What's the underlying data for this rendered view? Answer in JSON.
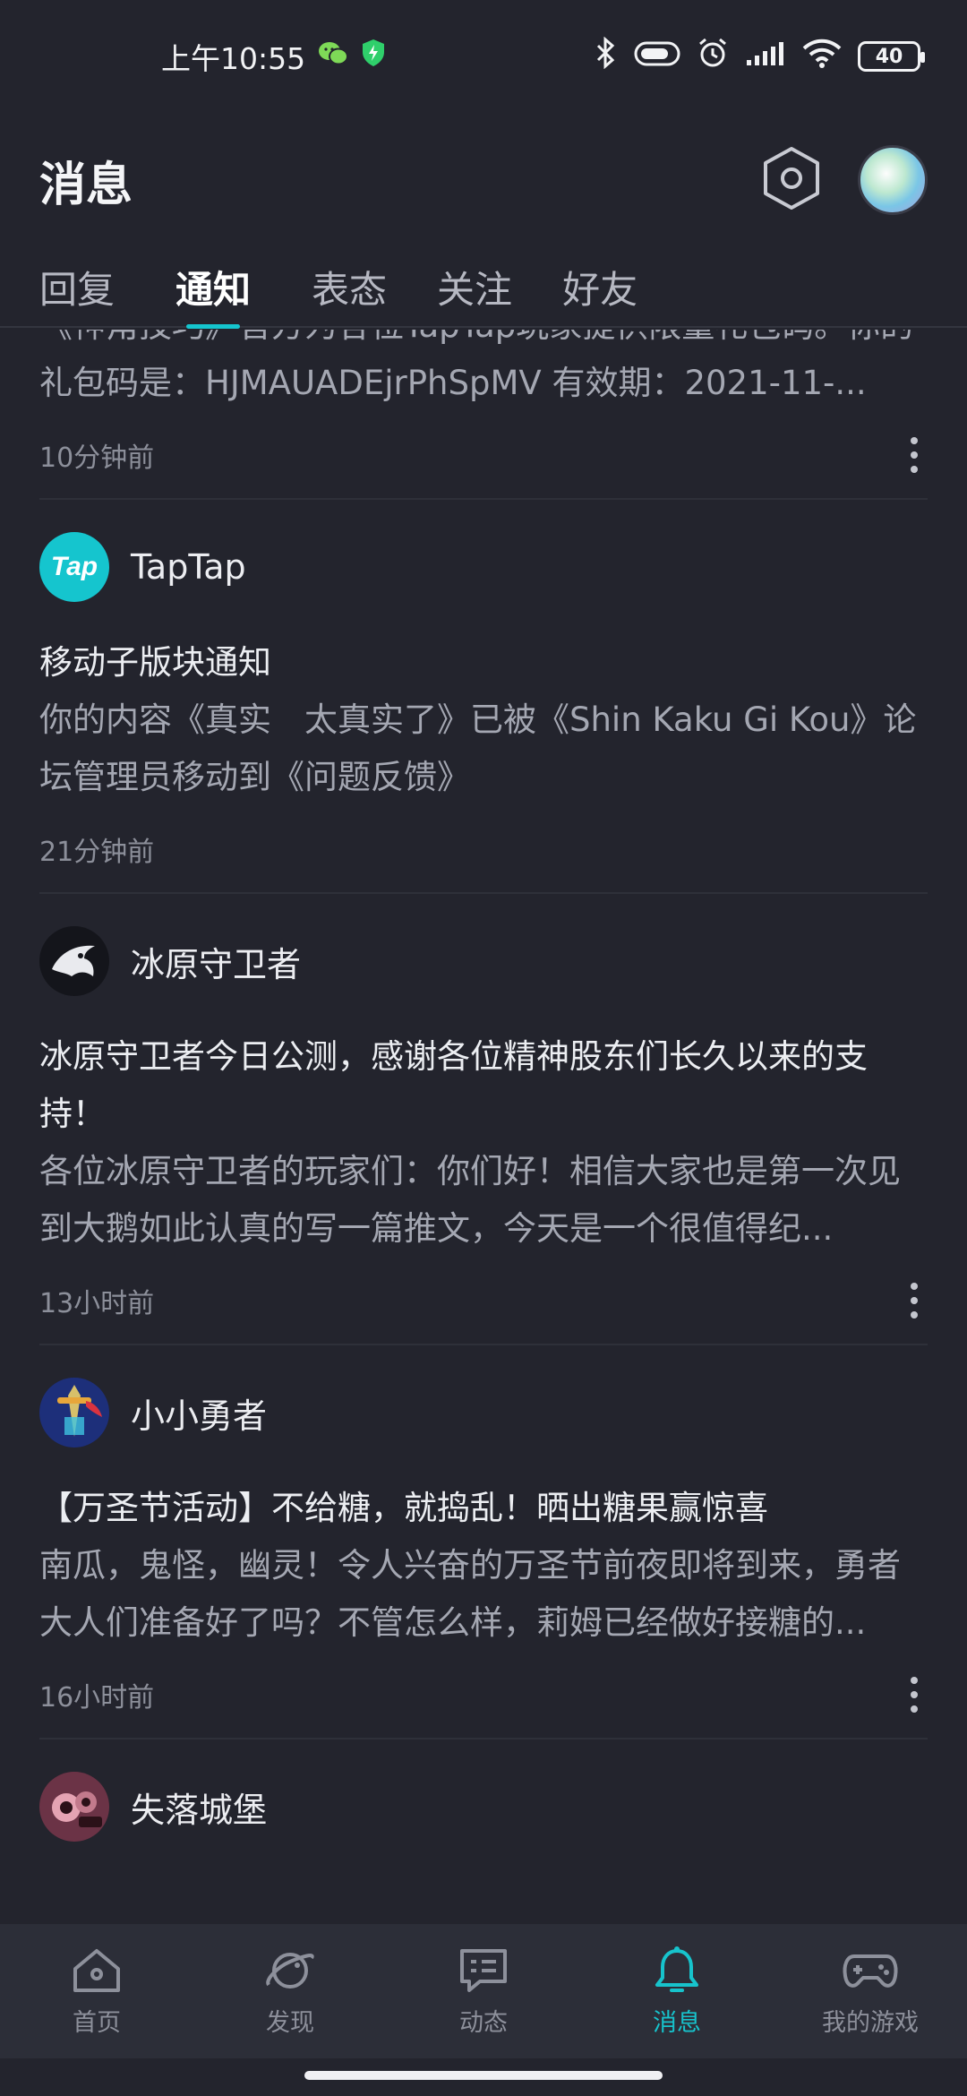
{
  "status_bar": {
    "time": "上午10:55",
    "battery": "40"
  },
  "header": {
    "title": "消息"
  },
  "tabs": [
    {
      "label": "回复"
    },
    {
      "label": "通知"
    },
    {
      "label": "表态"
    },
    {
      "label": "关注"
    },
    {
      "label": "好友"
    }
  ],
  "messages": [
    {
      "body": "《神角技巧》官方为各位TapTap玩家提供限量礼包码。你的礼包码是：HJMAUADEjrPhSpMV 有效期：2021-11-...",
      "time": "10分钟前"
    },
    {
      "sender": "TapTap",
      "avatar_text": "Tap",
      "title": "移动子版块通知",
      "body": "你的内容《真实　太真实了》已被《Shin Kaku Gi Kou》论坛管理员移动到《问题反馈》",
      "time": "21分钟前"
    },
    {
      "sender": "冰原守卫者",
      "title": "冰原守卫者今日公测，感谢各位精神股东们长久以来的支持！",
      "body": "各位冰原守卫者的玩家们：你们好！相信大家也是第一次见到大鹅如此认真的写一篇推文，今天是一个很值得纪...",
      "time": "13小时前"
    },
    {
      "sender": "小小勇者",
      "title": "【万圣节活动】不给糖，就捣乱！晒出糖果赢惊喜",
      "body": "南瓜，鬼怪，幽灵！令人兴奋的万圣节前夜即将到来，勇者大人们准备好了吗？不管怎么样，莉姆已经做好接糖的...",
      "time": "16小时前"
    },
    {
      "sender": "失落城堡"
    }
  ],
  "bottom_nav": [
    {
      "label": "首页"
    },
    {
      "label": "发现"
    },
    {
      "label": "动态"
    },
    {
      "label": "消息"
    },
    {
      "label": "我的游戏"
    }
  ],
  "colors": {
    "accent": "#15c5ce",
    "background": "#23242d",
    "nav_background": "#2c2e38"
  }
}
